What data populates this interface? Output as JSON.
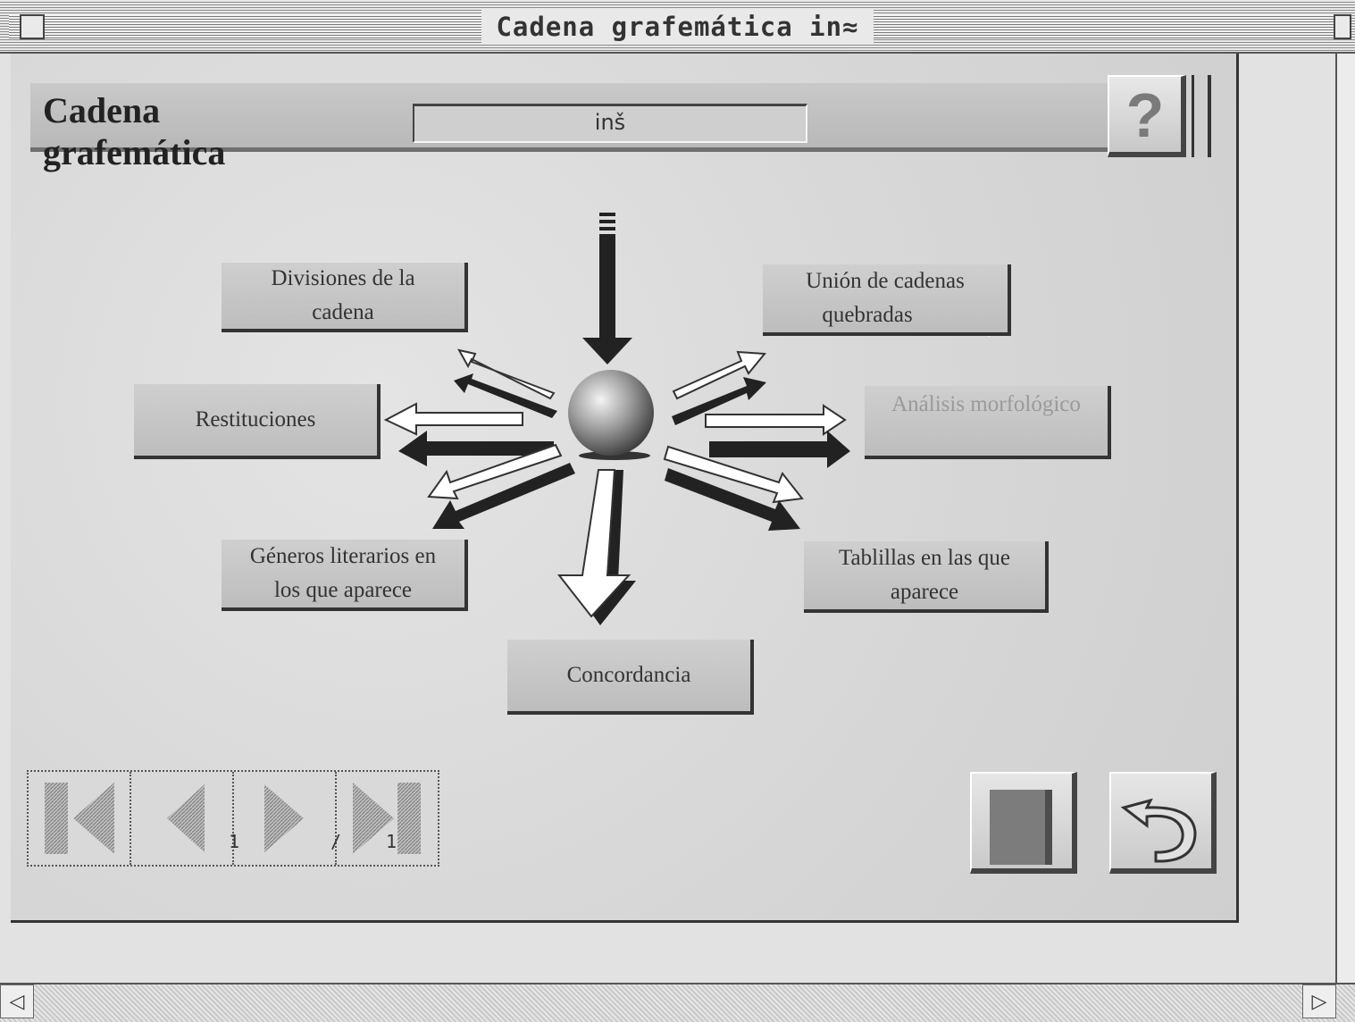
{
  "window": {
    "title": "Cadena grafemática in≈"
  },
  "header": {
    "title": "Cadena grafemática",
    "help_label": "?"
  },
  "string_field": {
    "value": "inš"
  },
  "buttons": {
    "divisiones": [
      "Divisiones de la",
      "cadena"
    ],
    "union": [
      "Unión de cadenas",
      "quebradas"
    ],
    "restituciones": "Restituciones",
    "analisis": "Análisis morfológico",
    "generos": [
      "Géneros literarios en",
      "los que aparece"
    ],
    "tablillas": [
      "Tablillas en las que",
      "aparece"
    ],
    "concordancia": "Concordancia"
  },
  "pager": {
    "current": "1",
    "separator": "/",
    "total": "1"
  },
  "icons": {
    "first": "first-page-icon",
    "prev": "previous-page-icon",
    "next": "next-page-icon",
    "last": "last-page-icon",
    "book": "book-icon",
    "back": "return-arrow-icon"
  }
}
